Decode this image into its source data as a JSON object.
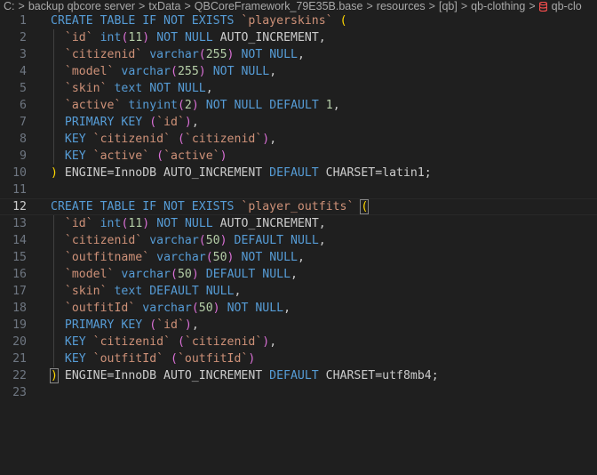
{
  "breadcrumb": {
    "items": [
      "C:",
      "backup qbcore server",
      "txData",
      "QBCoreFramework_79E35B.base",
      "resources",
      "[qb]",
      "qb-clothing",
      "qb-clo"
    ],
    "separator": ">"
  },
  "editor": {
    "current_line": 12,
    "lines": [
      {
        "n": "1",
        "tokens": [
          [
            "kw",
            "CREATE TABLE"
          ],
          [
            "plain",
            " "
          ],
          [
            "kw",
            "IF NOT EXISTS"
          ],
          [
            "plain",
            " "
          ],
          [
            "str",
            "`playerskins`"
          ],
          [
            "plain",
            " "
          ],
          [
            "br1",
            "("
          ]
        ]
      },
      {
        "n": "2",
        "tokens": [
          [
            "plain",
            "  "
          ],
          [
            "str",
            "`id`"
          ],
          [
            "plain",
            " "
          ],
          [
            "kw",
            "int"
          ],
          [
            "br2",
            "("
          ],
          [
            "num",
            "11"
          ],
          [
            "br2",
            ")"
          ],
          [
            "plain",
            " "
          ],
          [
            "kw",
            "NOT NULL"
          ],
          [
            "plain",
            " AUTO_INCREMENT,"
          ]
        ]
      },
      {
        "n": "3",
        "tokens": [
          [
            "plain",
            "  "
          ],
          [
            "str",
            "`citizenid`"
          ],
          [
            "plain",
            " "
          ],
          [
            "kw",
            "varchar"
          ],
          [
            "br2",
            "("
          ],
          [
            "num",
            "255"
          ],
          [
            "br2",
            ")"
          ],
          [
            "plain",
            " "
          ],
          [
            "kw",
            "NOT NULL"
          ],
          [
            "plain",
            ","
          ]
        ]
      },
      {
        "n": "4",
        "tokens": [
          [
            "plain",
            "  "
          ],
          [
            "str",
            "`model`"
          ],
          [
            "plain",
            " "
          ],
          [
            "kw",
            "varchar"
          ],
          [
            "br2",
            "("
          ],
          [
            "num",
            "255"
          ],
          [
            "br2",
            ")"
          ],
          [
            "plain",
            " "
          ],
          [
            "kw",
            "NOT NULL"
          ],
          [
            "plain",
            ","
          ]
        ]
      },
      {
        "n": "5",
        "tokens": [
          [
            "plain",
            "  "
          ],
          [
            "str",
            "`skin`"
          ],
          [
            "plain",
            " "
          ],
          [
            "kw",
            "text"
          ],
          [
            "plain",
            " "
          ],
          [
            "kw",
            "NOT NULL"
          ],
          [
            "plain",
            ","
          ]
        ]
      },
      {
        "n": "6",
        "tokens": [
          [
            "plain",
            "  "
          ],
          [
            "str",
            "`active`"
          ],
          [
            "plain",
            " "
          ],
          [
            "kw",
            "tinyint"
          ],
          [
            "br2",
            "("
          ],
          [
            "num",
            "2"
          ],
          [
            "br2",
            ")"
          ],
          [
            "plain",
            " "
          ],
          [
            "kw",
            "NOT NULL"
          ],
          [
            "plain",
            " "
          ],
          [
            "kw",
            "DEFAULT"
          ],
          [
            "plain",
            " "
          ],
          [
            "num",
            "1"
          ],
          [
            "plain",
            ","
          ]
        ]
      },
      {
        "n": "7",
        "tokens": [
          [
            "plain",
            "  "
          ],
          [
            "kw",
            "PRIMARY KEY"
          ],
          [
            "plain",
            " "
          ],
          [
            "br2",
            "("
          ],
          [
            "str",
            "`id`"
          ],
          [
            "br2",
            ")"
          ],
          [
            "plain",
            ","
          ]
        ]
      },
      {
        "n": "8",
        "tokens": [
          [
            "plain",
            "  "
          ],
          [
            "kw",
            "KEY"
          ],
          [
            "plain",
            " "
          ],
          [
            "str",
            "`citizenid`"
          ],
          [
            "plain",
            " "
          ],
          [
            "br2",
            "("
          ],
          [
            "str",
            "`citizenid`"
          ],
          [
            "br2",
            ")"
          ],
          [
            "plain",
            ","
          ]
        ]
      },
      {
        "n": "9",
        "tokens": [
          [
            "plain",
            "  "
          ],
          [
            "kw",
            "KEY"
          ],
          [
            "plain",
            " "
          ],
          [
            "str",
            "`active`"
          ],
          [
            "plain",
            " "
          ],
          [
            "br2",
            "("
          ],
          [
            "str",
            "`active`"
          ],
          [
            "br2",
            ")"
          ]
        ]
      },
      {
        "n": "10",
        "tokens": [
          [
            "br1",
            ")"
          ],
          [
            "plain",
            " ENGINE=InnoDB AUTO_INCREMENT "
          ],
          [
            "kw",
            "DEFAULT"
          ],
          [
            "plain",
            " CHARSET=latin1;"
          ]
        ]
      },
      {
        "n": "11",
        "tokens": []
      },
      {
        "n": "12",
        "tokens": [
          [
            "kw",
            "CREATE TABLE"
          ],
          [
            "plain",
            " "
          ],
          [
            "kw",
            "IF NOT EXISTS"
          ],
          [
            "plain",
            " "
          ],
          [
            "str",
            "`player_outfits`"
          ],
          [
            "plain",
            " "
          ],
          [
            "br1hl",
            "("
          ]
        ]
      },
      {
        "n": "13",
        "tokens": [
          [
            "plain",
            "  "
          ],
          [
            "str",
            "`id`"
          ],
          [
            "plain",
            " "
          ],
          [
            "kw",
            "int"
          ],
          [
            "br2",
            "("
          ],
          [
            "num",
            "11"
          ],
          [
            "br2",
            ")"
          ],
          [
            "plain",
            " "
          ],
          [
            "kw",
            "NOT NULL"
          ],
          [
            "plain",
            " AUTO_INCREMENT,"
          ]
        ]
      },
      {
        "n": "14",
        "tokens": [
          [
            "plain",
            "  "
          ],
          [
            "str",
            "`citizenid`"
          ],
          [
            "plain",
            " "
          ],
          [
            "kw",
            "varchar"
          ],
          [
            "br2",
            "("
          ],
          [
            "num",
            "50"
          ],
          [
            "br2",
            ")"
          ],
          [
            "plain",
            " "
          ],
          [
            "kw",
            "DEFAULT NULL"
          ],
          [
            "plain",
            ","
          ]
        ]
      },
      {
        "n": "15",
        "tokens": [
          [
            "plain",
            "  "
          ],
          [
            "str",
            "`outfitname`"
          ],
          [
            "plain",
            " "
          ],
          [
            "kw",
            "varchar"
          ],
          [
            "br2",
            "("
          ],
          [
            "num",
            "50"
          ],
          [
            "br2",
            ")"
          ],
          [
            "plain",
            " "
          ],
          [
            "kw",
            "NOT NULL"
          ],
          [
            "plain",
            ","
          ]
        ]
      },
      {
        "n": "16",
        "tokens": [
          [
            "plain",
            "  "
          ],
          [
            "str",
            "`model`"
          ],
          [
            "plain",
            " "
          ],
          [
            "kw",
            "varchar"
          ],
          [
            "br2",
            "("
          ],
          [
            "num",
            "50"
          ],
          [
            "br2",
            ")"
          ],
          [
            "plain",
            " "
          ],
          [
            "kw",
            "DEFAULT NULL"
          ],
          [
            "plain",
            ","
          ]
        ]
      },
      {
        "n": "17",
        "tokens": [
          [
            "plain",
            "  "
          ],
          [
            "str",
            "`skin`"
          ],
          [
            "plain",
            " "
          ],
          [
            "kw",
            "text"
          ],
          [
            "plain",
            " "
          ],
          [
            "kw",
            "DEFAULT NULL"
          ],
          [
            "plain",
            ","
          ]
        ]
      },
      {
        "n": "18",
        "tokens": [
          [
            "plain",
            "  "
          ],
          [
            "str",
            "`outfitId`"
          ],
          [
            "plain",
            " "
          ],
          [
            "kw",
            "varchar"
          ],
          [
            "br2",
            "("
          ],
          [
            "num",
            "50"
          ],
          [
            "br2",
            ")"
          ],
          [
            "plain",
            " "
          ],
          [
            "kw",
            "NOT NULL"
          ],
          [
            "plain",
            ","
          ]
        ]
      },
      {
        "n": "19",
        "tokens": [
          [
            "plain",
            "  "
          ],
          [
            "kw",
            "PRIMARY KEY"
          ],
          [
            "plain",
            " "
          ],
          [
            "br2",
            "("
          ],
          [
            "str",
            "`id`"
          ],
          [
            "br2",
            ")"
          ],
          [
            "plain",
            ","
          ]
        ]
      },
      {
        "n": "20",
        "tokens": [
          [
            "plain",
            "  "
          ],
          [
            "kw",
            "KEY"
          ],
          [
            "plain",
            " "
          ],
          [
            "str",
            "`citizenid`"
          ],
          [
            "plain",
            " "
          ],
          [
            "br2",
            "("
          ],
          [
            "str",
            "`citizenid`"
          ],
          [
            "br2",
            ")"
          ],
          [
            "plain",
            ","
          ]
        ]
      },
      {
        "n": "21",
        "tokens": [
          [
            "plain",
            "  "
          ],
          [
            "kw",
            "KEY"
          ],
          [
            "plain",
            " "
          ],
          [
            "str",
            "`outfitId`"
          ],
          [
            "plain",
            " "
          ],
          [
            "br2",
            "("
          ],
          [
            "str",
            "`outfitId`"
          ],
          [
            "br2",
            ")"
          ]
        ]
      },
      {
        "n": "22",
        "tokens": [
          [
            "br1hl",
            ")"
          ],
          [
            "plain",
            " ENGINE=InnoDB AUTO_INCREMENT "
          ],
          [
            "kw",
            "DEFAULT"
          ],
          [
            "plain",
            " CHARSET=utf8mb4;"
          ]
        ]
      },
      {
        "n": "23",
        "tokens": []
      }
    ]
  },
  "colors": {
    "background": "#1f1f1f",
    "keyword": "#569cd6",
    "string": "#ce9178",
    "number": "#b5cea8",
    "bracket_level1": "#ffd700",
    "bracket_level2": "#da70d6",
    "text": "#cccccc",
    "line_number": "#6e7681",
    "db_icon": "#f14c4c"
  },
  "icons": {
    "file_icon": "database-icon"
  }
}
